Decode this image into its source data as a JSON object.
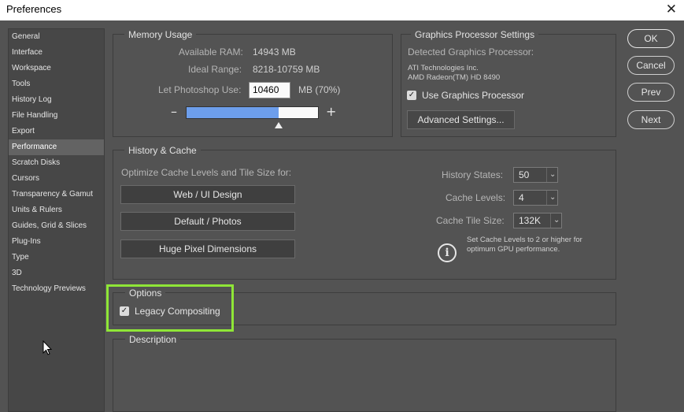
{
  "window": {
    "title": "Preferences",
    "close_glyph": "✕"
  },
  "sidebar": {
    "items": [
      {
        "label": "General"
      },
      {
        "label": "Interface"
      },
      {
        "label": "Workspace"
      },
      {
        "label": "Tools"
      },
      {
        "label": "History Log"
      },
      {
        "label": "File Handling"
      },
      {
        "label": "Export"
      },
      {
        "label": "Performance",
        "active": true
      },
      {
        "label": "Scratch Disks"
      },
      {
        "label": "Cursors"
      },
      {
        "label": "Transparency & Gamut"
      },
      {
        "label": "Units & Rulers"
      },
      {
        "label": "Guides, Grid & Slices"
      },
      {
        "label": "Plug-Ins"
      },
      {
        "label": "Type"
      },
      {
        "label": "3D"
      },
      {
        "label": "Technology Previews"
      }
    ]
  },
  "memory": {
    "title": "Memory Usage",
    "available_label": "Available RAM:",
    "available_value": "14943 MB",
    "ideal_label": "Ideal Range:",
    "ideal_value": "8218-10759 MB",
    "use_label": "Let Photoshop Use:",
    "use_value": "10460",
    "use_unit": "MB (70%)",
    "slider_fraction": 0.7,
    "minus": "–",
    "plus": "+"
  },
  "gpu": {
    "title": "Graphics Processor Settings",
    "detected_label": "Detected Graphics Processor:",
    "vendor": "ATI Technologies Inc.",
    "model": "AMD Radeon(TM) HD 8490",
    "use_gpu_label": "Use Graphics Processor",
    "use_gpu_checked": true,
    "advanced_button": "Advanced Settings..."
  },
  "history_cache": {
    "title": "History & Cache",
    "optimize_label": "Optimize Cache Levels and Tile Size for:",
    "buttons": [
      "Web / UI Design",
      "Default / Photos",
      "Huge Pixel Dimensions"
    ],
    "history_states_label": "History States:",
    "history_states_value": "50",
    "cache_levels_label": "Cache Levels:",
    "cache_levels_value": "4",
    "tile_size_label": "Cache Tile Size:",
    "tile_size_value": "132K",
    "hint_line1": "Set Cache Levels to 2 or higher for",
    "hint_line2": "optimum GPU performance.",
    "info_glyph": "i"
  },
  "options": {
    "title": "Options",
    "legacy_label": "Legacy Compositing",
    "legacy_checked": true
  },
  "description": {
    "title": "Description"
  },
  "dialog_buttons": {
    "ok": "OK",
    "cancel": "Cancel",
    "prev": "Prev",
    "next": "Next"
  },
  "colors": {
    "highlight": "#8fe637",
    "slider_fill": "#6d9eeb",
    "background": "#535353"
  }
}
